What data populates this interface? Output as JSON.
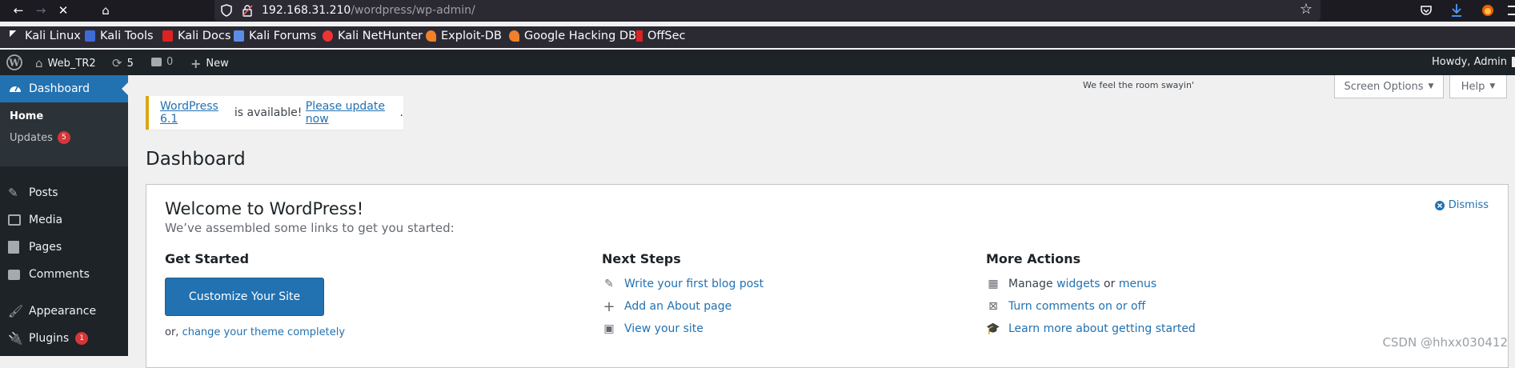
{
  "browser": {
    "back_icon": "←",
    "forward_icon": "→",
    "stop_icon": "✕",
    "home_icon": "⌂",
    "url_host": "192.168.31.210",
    "url_path": "/wordpress/wp-admin/",
    "star_icon": "☆"
  },
  "bookmarks": [
    {
      "label": "Kali Linux"
    },
    {
      "label": "Kali Tools"
    },
    {
      "label": "Kali Docs"
    },
    {
      "label": "Kali Forums"
    },
    {
      "label": "Kali NetHunter"
    },
    {
      "label": "Exploit-DB"
    },
    {
      "label": "Google Hacking DB"
    },
    {
      "label": "OffSec"
    }
  ],
  "adminbar": {
    "site_name": "Web_TR2",
    "updates_count": "5",
    "comments_count": "0",
    "new_label": "New",
    "howdy": "Howdy, Admin"
  },
  "sidebar": {
    "dashboard": "Dashboard",
    "home": "Home",
    "updates": "Updates",
    "updates_badge": "5",
    "posts": "Posts",
    "media": "Media",
    "pages": "Pages",
    "comments": "Comments",
    "appearance": "Appearance",
    "plugins": "Plugins",
    "plugins_badge": "1"
  },
  "header": {
    "hello_dolly": "We feel the room swayin'",
    "screen_options": "Screen Options",
    "help": "Help"
  },
  "notice": {
    "version_link": "WordPress 6.1",
    "middle": " is available! ",
    "update_link": "Please update now",
    "end": "."
  },
  "page_title": "Dashboard",
  "welcome": {
    "title": "Welcome to WordPress!",
    "subtitle": "We’ve assembled some links to get you started:",
    "dismiss": "Dismiss",
    "get_started": "Get Started",
    "customize": "Customize Your Site",
    "or": "or,",
    "change_theme": "change your theme completely",
    "next_steps": "Next Steps",
    "write_post": "Write your first blog post",
    "add_about": "Add an About page",
    "view_site": "View your site",
    "more_actions": "More Actions",
    "manage": "Manage",
    "widgets": "widgets",
    "or_word": "or",
    "menus": "menus",
    "comments_toggle": "Turn comments on or off",
    "learn_more": "Learn more about getting started"
  },
  "watermark": "CSDN @hhxx030412"
}
